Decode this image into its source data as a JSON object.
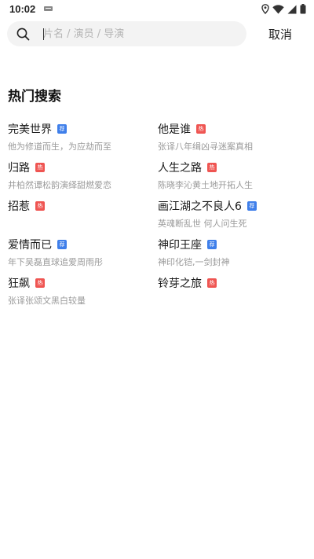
{
  "status_bar": {
    "time": "10:02",
    "icons": [
      "notification-icon",
      "location-icon",
      "wifi-icon",
      "signal-icon",
      "battery-icon"
    ]
  },
  "search": {
    "placeholder": "片名 / 演员 / 导演",
    "value": "",
    "cancel_label": "取消"
  },
  "section": {
    "title": "热门搜索"
  },
  "badges": {
    "hot": "热",
    "recommend": "荐"
  },
  "colors": {
    "hot_badge": "#ef5552",
    "recommend_badge": "#3f7fea"
  },
  "items": [
    {
      "title": "完美世界",
      "badge": "荐",
      "badge_type": "recommend",
      "desc": "他为修道而生，为应劫而至"
    },
    {
      "title": "他是谁",
      "badge": "热",
      "badge_type": "hot",
      "desc": "张译八年缉凶寻迷案真相"
    },
    {
      "title": "归路",
      "badge": "热",
      "badge_type": "hot",
      "desc": "井柏然谭松韵演绎甜燃爱恋"
    },
    {
      "title": "人生之路",
      "badge": "热",
      "badge_type": "hot",
      "desc": "陈晓李沁黄土地开拓人生"
    },
    {
      "title": "招惹",
      "badge": "热",
      "badge_type": "hot",
      "desc": ""
    },
    {
      "title": "画江湖之不良人6",
      "badge": "荐",
      "badge_type": "recommend",
      "desc": "英魂断乱世 何人问生死"
    },
    {
      "title": "爱情而已",
      "badge": "荐",
      "badge_type": "recommend",
      "desc": "年下吴磊直球追爱周雨彤"
    },
    {
      "title": "神印王座",
      "badge": "荐",
      "badge_type": "recommend",
      "desc": "神印化铠,一剑封神"
    },
    {
      "title": "狂飙",
      "badge": "热",
      "badge_type": "hot",
      "desc": "张译张颂文黑白较量"
    },
    {
      "title": "铃芽之旅",
      "badge": "热",
      "badge_type": "hot",
      "desc": ""
    }
  ]
}
